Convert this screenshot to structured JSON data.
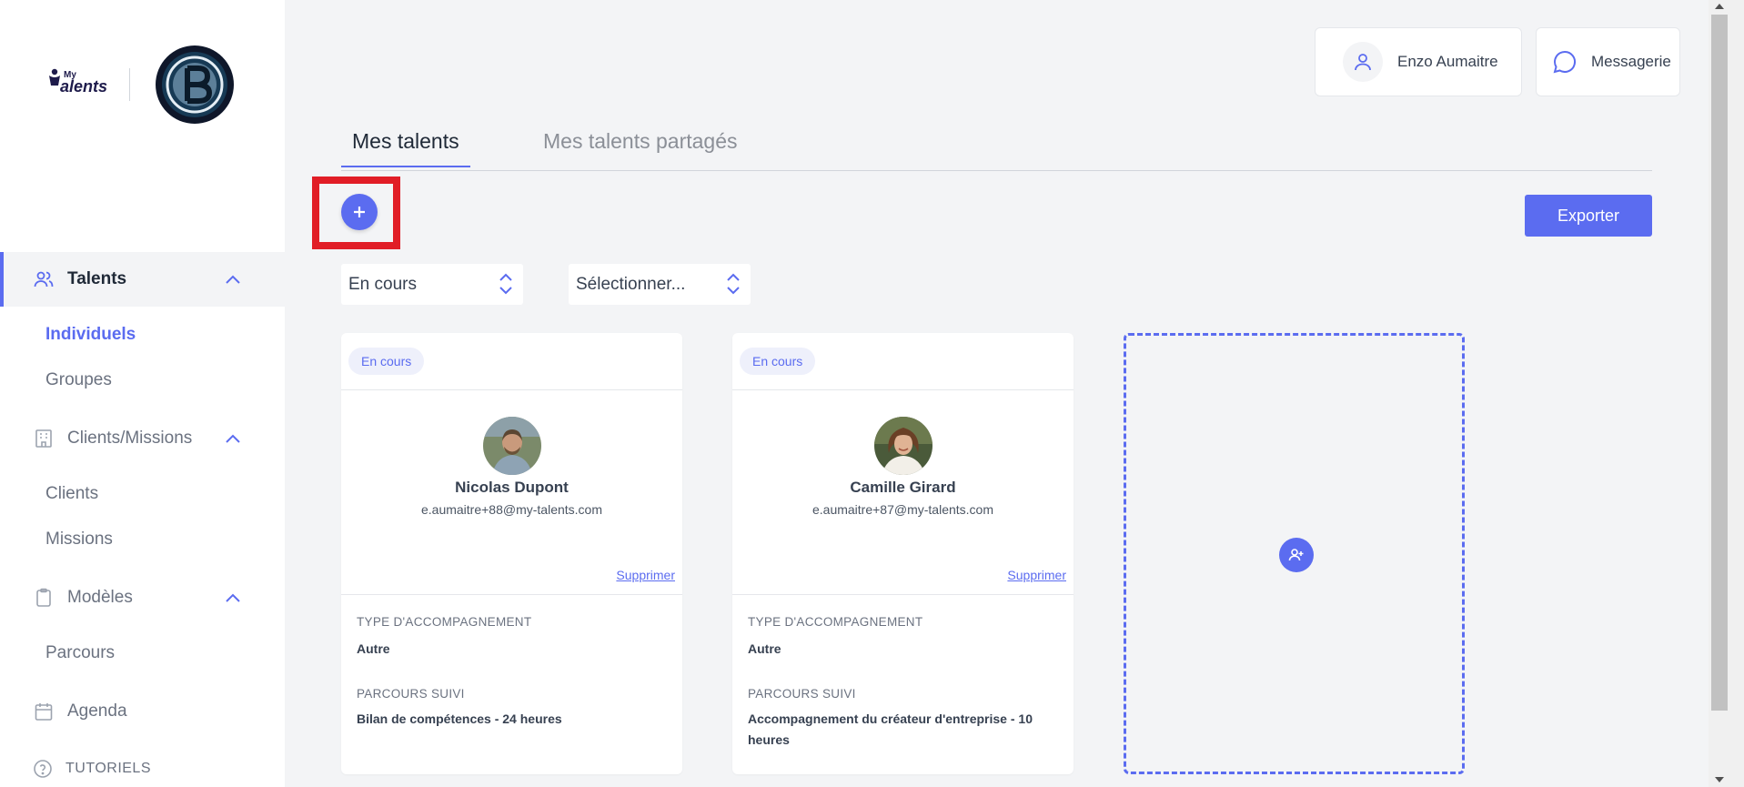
{
  "brand": {
    "logo_my": "My",
    "logo_name": "alents"
  },
  "sidebar": {
    "sections": [
      {
        "label": "Talents",
        "icon": "users-icon"
      },
      {
        "label": "Clients/Missions",
        "icon": "building-icon"
      },
      {
        "label": "Modèles",
        "icon": "clipboard-icon"
      },
      {
        "label": "Agenda",
        "icon": "calendar-icon"
      }
    ],
    "talents_sub": [
      "Individuels",
      "Groupes"
    ],
    "clients_sub": [
      "Clients",
      "Missions"
    ],
    "modeles_sub": [
      "Parcours"
    ],
    "tutoriels": "TUTORIELS"
  },
  "header": {
    "user_name": "Enzo Aumaitre",
    "messaging": "Messagerie"
  },
  "tabs": [
    {
      "label": "Mes talents"
    },
    {
      "label": "Mes talents partagés"
    }
  ],
  "actions": {
    "export": "Exporter"
  },
  "filters": {
    "status": "En cours",
    "select_placeholder": "Sélectionner..."
  },
  "field_labels": {
    "type": "TYPE D'ACCOMPAGNEMENT",
    "parcours": "PARCOURS SUIVI"
  },
  "cards": [
    {
      "status": "En cours",
      "name": "Nicolas Dupont",
      "email": "e.aumaitre+88@my-talents.com",
      "delete": "Supprimer",
      "type": "Autre",
      "parcours": "Bilan de compétences - 24 heures"
    },
    {
      "status": "En cours",
      "name": "Camille Girard",
      "email": "e.aumaitre+87@my-talents.com",
      "delete": "Supprimer",
      "type": "Autre",
      "parcours": "Accompagnement du créateur d'entreprise - 10 heures"
    }
  ],
  "colors": {
    "accent": "#5b6cf0",
    "highlight": "#e11d26",
    "background": "#f3f4f6"
  }
}
